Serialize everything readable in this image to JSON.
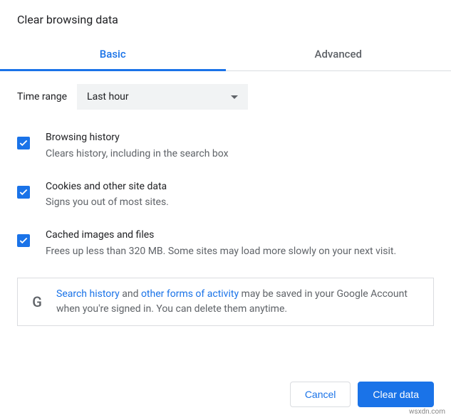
{
  "title": "Clear browsing data",
  "tabs": {
    "basic": "Basic",
    "advanced": "Advanced"
  },
  "timeRange": {
    "label": "Time range",
    "value": "Last hour"
  },
  "options": [
    {
      "title": "Browsing history",
      "desc": "Clears history, including in the search box",
      "checked": true
    },
    {
      "title": "Cookies and other site data",
      "desc": "Signs you out of most sites.",
      "checked": true
    },
    {
      "title": "Cached images and files",
      "desc": "Frees up less than 320 MB. Some sites may load more slowly on your next visit.",
      "checked": true
    }
  ],
  "info": {
    "link1": "Search history",
    "mid1": " and ",
    "link2": "other forms of activity",
    "rest": " may be saved in your Google Account when you're signed in. You can delete them anytime."
  },
  "buttons": {
    "cancel": "Cancel",
    "clear": "Clear data"
  },
  "watermark": "wsxdn.com"
}
